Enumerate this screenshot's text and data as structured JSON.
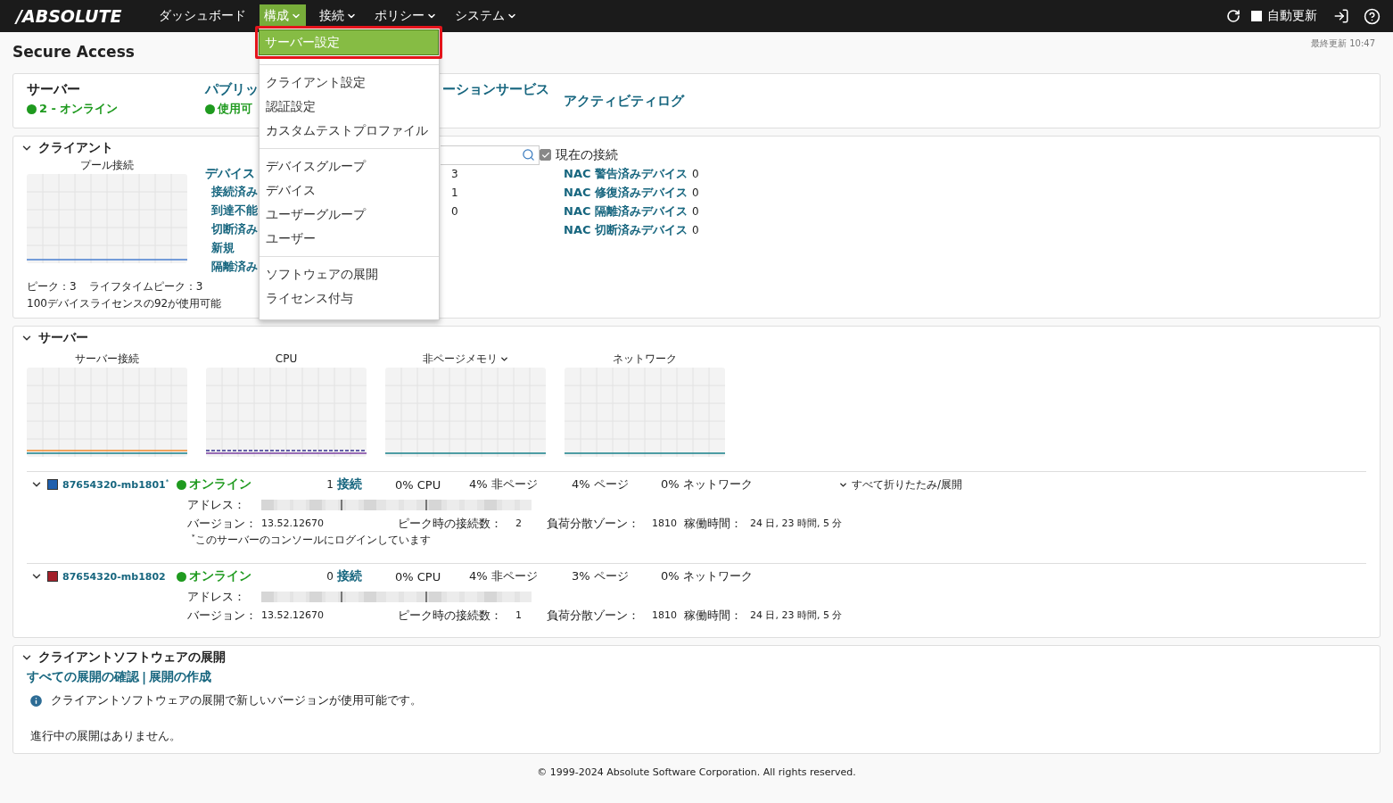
{
  "header": {
    "logo": "/ABSOLUTE",
    "nav": [
      {
        "label": "ダッシュボード",
        "has_menu": false,
        "selected": false
      },
      {
        "label": "構成",
        "has_menu": true,
        "selected": true
      },
      {
        "label": "接続",
        "has_menu": true,
        "selected": false
      },
      {
        "label": "ポリシー",
        "has_menu": true,
        "selected": false
      },
      {
        "label": "システム",
        "has_menu": true,
        "selected": false
      }
    ],
    "auto_refresh": {
      "label": "自動更新",
      "checked": false
    }
  },
  "menu": {
    "groups": [
      [
        {
          "label": "サーバー設定",
          "selected": true
        }
      ],
      [
        {
          "label": "クライアント設定",
          "selected": false
        },
        {
          "label": "認証設定",
          "selected": false
        },
        {
          "label": "カスタムテストプロファイル",
          "selected": false
        }
      ],
      [
        {
          "label": "デバイスグループ",
          "selected": false
        },
        {
          "label": "デバイス",
          "selected": false
        },
        {
          "label": "ユーザーグループ",
          "selected": false
        },
        {
          "label": "ユーザー",
          "selected": false
        }
      ],
      [
        {
          "label": "ソフトウェアの展開",
          "selected": false
        },
        {
          "label": "ライセンス付与",
          "selected": false
        }
      ]
    ]
  },
  "page": {
    "title": "Secure Access",
    "last_updated": "最終更新 10:47"
  },
  "summary": [
    {
      "kind": "status",
      "title": "サーバー",
      "title_link": false,
      "status": "2 - オンライン"
    },
    {
      "kind": "status",
      "title": "パブリッ",
      "title_link": true,
      "status": "使用可"
    },
    {
      "kind": "heading",
      "title": "ーションサービス"
    },
    {
      "kind": "link",
      "title": "アクティビティログ"
    }
  ],
  "clients": {
    "title": "クライアント",
    "expanded": true,
    "pool_title": "プール接続",
    "peak": "ピーク：3",
    "lifetime_peak": "ライフタイムピーク：3",
    "license": "100デバイスライセンスの92が使用可能",
    "devices_heading": "デバイス",
    "device_links": [
      "接続済み",
      "到達不能",
      "切断済み",
      "新規",
      "隔離済み"
    ],
    "counts": [
      "3",
      "1",
      "0"
    ],
    "current_connections": {
      "label": "現在の接続",
      "checked": true
    },
    "nac": [
      {
        "label": "NAC 警告済みデバイス",
        "count": "0"
      },
      {
        "label": "NAC 修復済みデバイス",
        "count": "0"
      },
      {
        "label": "NAC 隔離済みデバイス",
        "count": "0"
      },
      {
        "label": "NAC 切断済みデバイス",
        "count": "0"
      }
    ]
  },
  "servers": {
    "title": "サーバー",
    "expanded": true,
    "charts": [
      {
        "title": "サーバー接続",
        "has_menu": false
      },
      {
        "title": "CPU",
        "has_menu": false
      },
      {
        "title": "非ページメモリ",
        "has_menu": true
      },
      {
        "title": "ネットワーク",
        "has_menu": false
      }
    ],
    "toggle_all": "すべて折りたたみ/展開",
    "rows": [
      {
        "expanded": true,
        "name": "87654320-mb1801$^{*}$",
        "color": "#1f5fae",
        "status": "オンライン",
        "connections_count": "1",
        "connections_label": "接続",
        "cpu": "0% CPU",
        "nonpaged": "4% 非ページ",
        "paged": "4% ページ",
        "network": "0% ネットワーク",
        "address_label": "アドレス：",
        "version_label": "バージョン：",
        "version": "13.52.12670",
        "peak_label": "ピーク時の接続数：",
        "peak": "2",
        "zone_label": "負荷分散ゾーン：",
        "zone": "1810",
        "uptime_label": "稼働時間：",
        "uptime": "24 日, 23 時間, 5 分",
        "note": "$^{*}$このサーバーのコンソールにログインしています"
      },
      {
        "expanded": true,
        "name": "87654320-mb1802",
        "color": "#a3202a",
        "status": "オンライン",
        "connections_count": "0",
        "connections_label": "接続",
        "cpu": "0% CPU",
        "nonpaged": "4% 非ページ",
        "paged": "3% ページ",
        "network": "0% ネットワーク",
        "address_label": "アドレス：",
        "version_label": "バージョン：",
        "version": "13.52.12670",
        "peak_label": "ピーク時の接続数：",
        "peak": "1",
        "zone_label": "負荷分散ゾーン：",
        "zone": "1810",
        "uptime_label": "稼働時間：",
        "uptime": "24 日, 23 時間, 5 分"
      }
    ]
  },
  "deployment": {
    "title": "クライアントソフトウェアの展開",
    "expanded": true,
    "links": [
      "すべての展開の確認",
      "展開の作成"
    ],
    "separator": "|",
    "info": "クライアントソフトウェアの展開で新しいバージョンが使用可能です。",
    "status": "進行中の展開はありません。"
  },
  "footer": "© 1999-2024 Absolute Software Corporation. All rights reserved."
}
